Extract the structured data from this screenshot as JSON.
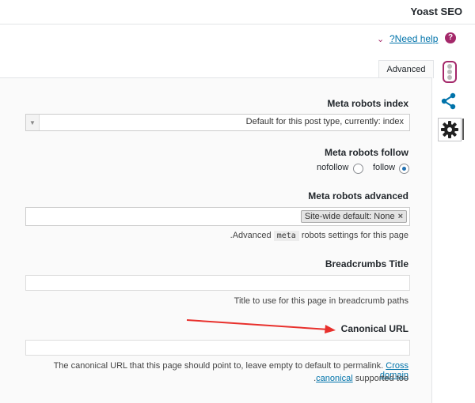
{
  "header": {
    "title": "Yoast SEO"
  },
  "help": {
    "chevron": "⌄",
    "link_label": "?Need help",
    "icon": "question-icon",
    "icon_glyph": "?"
  },
  "tabs": [
    {
      "label": "Advanced"
    }
  ],
  "rail": {
    "icons": [
      "traffic-light-icon",
      "share-icon",
      "gear-icon"
    ]
  },
  "fields": {
    "robots_index": {
      "label": "Meta robots index",
      "value": "Default for this post type, currently: index"
    },
    "robots_follow": {
      "label": "Meta robots follow",
      "options": [
        {
          "label": "nofollow",
          "checked": false
        },
        {
          "label": "follow",
          "checked": true
        }
      ]
    },
    "robots_advanced": {
      "label": "Meta robots advanced",
      "chip": "Site-wide default: None",
      "chip_remove": "×",
      "help_prefix": ".Advanced",
      "help_code": "meta",
      "help_suffix": "robots settings for this page"
    },
    "breadcrumbs": {
      "label": "Breadcrumbs Title",
      "value": "",
      "help": "Title to use for this page in breadcrumb paths"
    },
    "canonical": {
      "label": "Canonical URL",
      "value": "",
      "help": "The canonical URL that this page should point to, leave empty to default to permalink.",
      "link_part1": "Cross domain",
      "link_part2": "canonical",
      "help_end": "supported too",
      "lead_dot": "."
    }
  },
  "colors": {
    "accent": "#a4286a",
    "link": "#0073aa",
    "arrow": "#e8302c"
  }
}
